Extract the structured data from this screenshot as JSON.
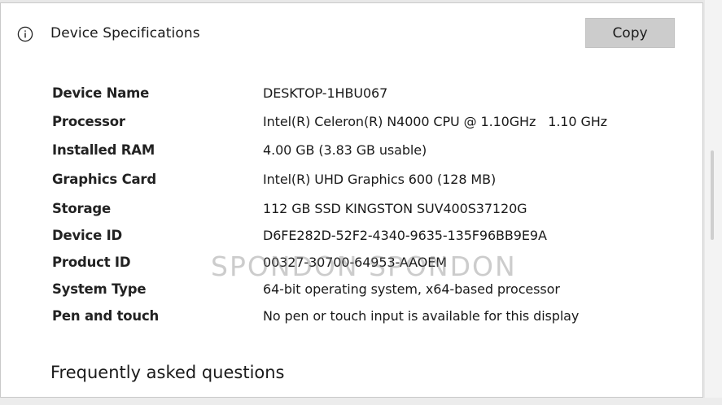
{
  "header": {
    "title": "Device Specifications",
    "copy_label": "Copy"
  },
  "specs": [
    {
      "label": "Device Name",
      "value": "DESKTOP-1HBU067"
    },
    {
      "label": "Processor",
      "value": "Intel(R) Celeron(R) N4000 CPU @ 1.10GHz   1.10 GHz"
    },
    {
      "label": "Installed RAM",
      "value": "4.00 GB (3.83 GB usable)"
    },
    {
      "label": "Graphics Card",
      "value": "Intel(R) UHD Graphics 600 (128 MB)"
    },
    {
      "label": "Storage",
      "value": "112 GB SSD KINGSTON SUV400S37120G"
    },
    {
      "label": "Device ID",
      "value": "D6FE282D-52F2-4340-9635-135F96BB9E9A"
    },
    {
      "label": "Product ID",
      "value": "00327-30700-64953-AAOEM"
    },
    {
      "label": "System Type",
      "value": "64-bit operating system, x64-based processor"
    },
    {
      "label": "Pen and touch",
      "value": "No pen or touch input is available for this display"
    }
  ],
  "watermark": "SPONDON SPONDON",
  "faq_link": "Frequently asked questions",
  "icons": {
    "info": "info-icon"
  }
}
